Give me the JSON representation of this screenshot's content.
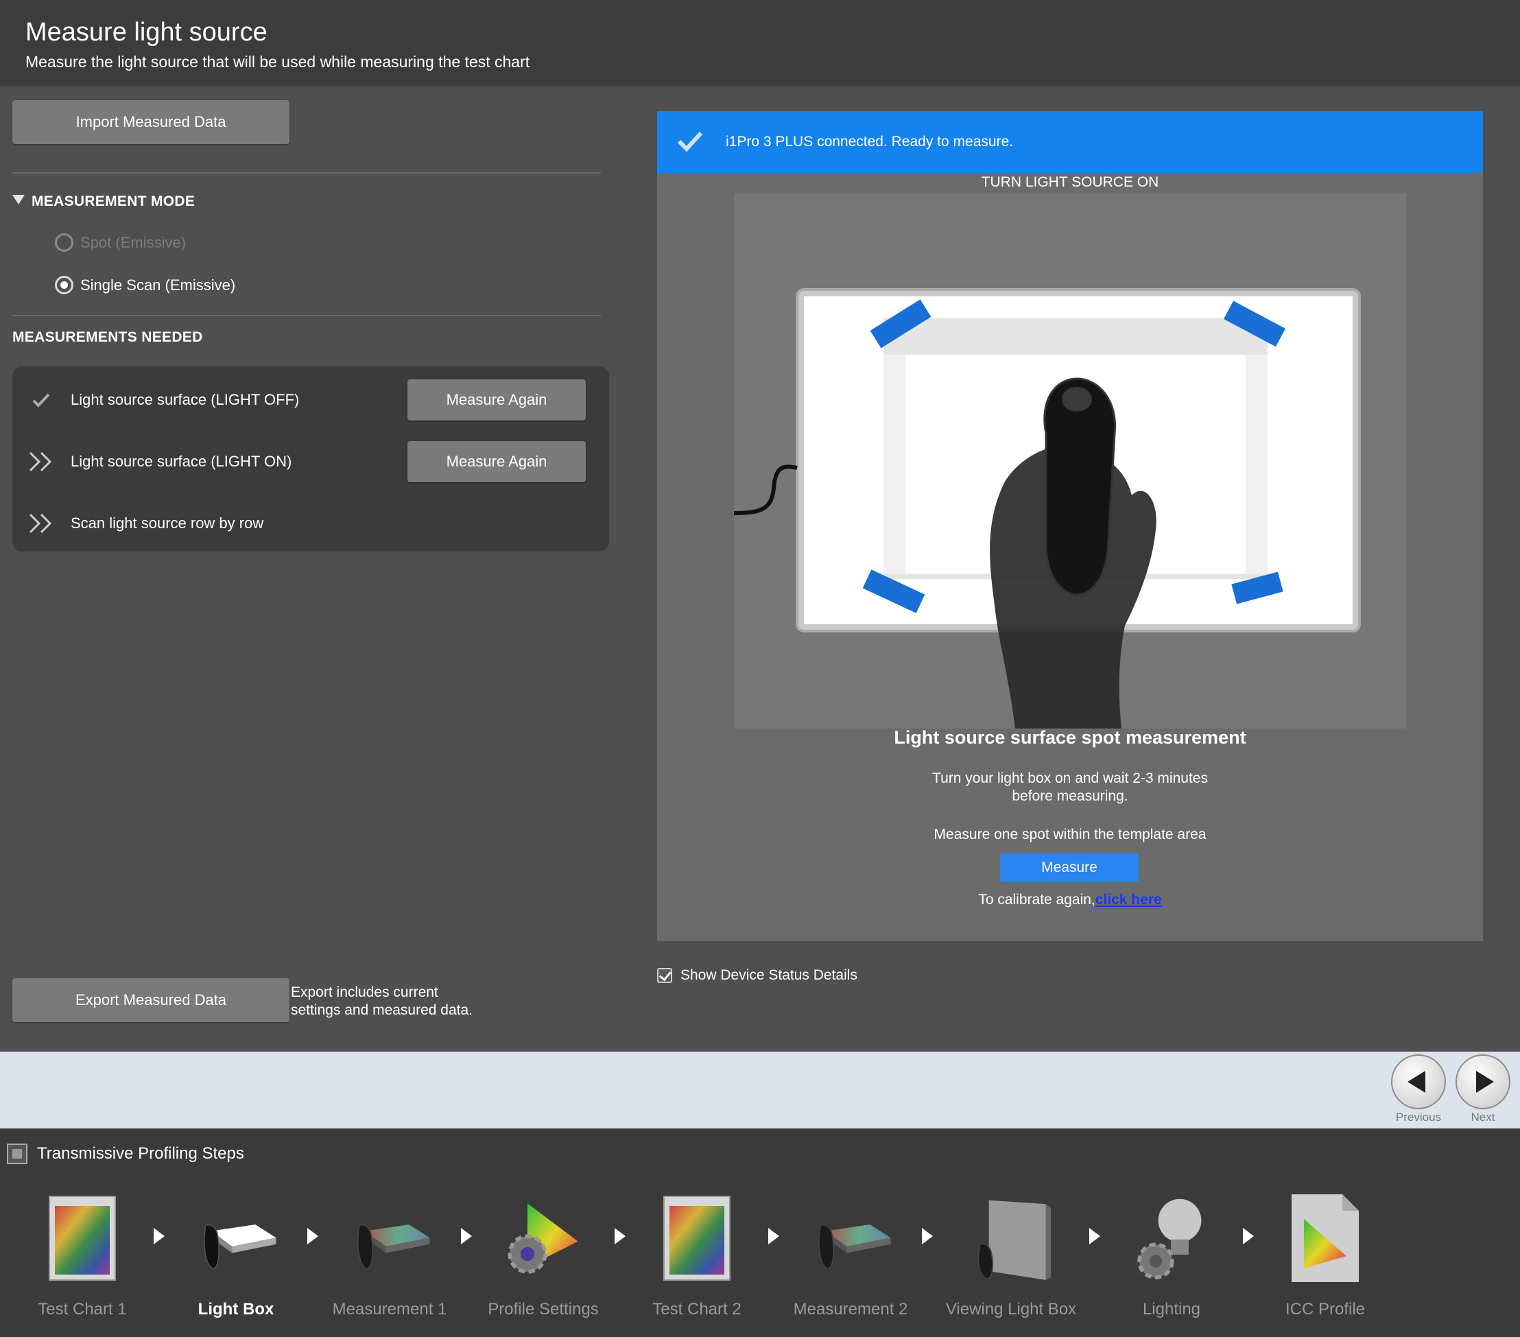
{
  "header": {
    "title": "Measure light source",
    "subtitle": "Measure the light source that will be used while measuring the test chart"
  },
  "left": {
    "import_label": "Import Measured Data",
    "mode_heading": "MEASUREMENT MODE",
    "mode_options": [
      {
        "label": "Spot (Emissive)",
        "selected": false,
        "enabled": false
      },
      {
        "label": "Single Scan (Emissive)",
        "selected": true,
        "enabled": true
      }
    ],
    "needed_heading": "MEASUREMENTS NEEDED",
    "measurements": [
      {
        "label": "Light source surface (LIGHT OFF)",
        "status": "done",
        "button": "Measure Again"
      },
      {
        "label": "Light source surface (LIGHT ON)",
        "status": "current",
        "button": "Measure Again"
      },
      {
        "label": "Scan light source row by row",
        "status": "pending",
        "button": ""
      }
    ],
    "export_label": "Export Measured Data",
    "export_note_1": "Export includes current",
    "export_note_2": "settings and measured data."
  },
  "right": {
    "status_text": "i1Pro 3 PLUS connected. Ready to measure.",
    "instruction_heading": "TURN LIGHT SOURCE ON",
    "title": "Light source surface spot measurement",
    "para1_line1": "Turn your light box on and wait 2-3 minutes",
    "para1_line2": "before measuring.",
    "para2": "Measure one spot within the template area",
    "measure_label": "Measure",
    "calibrate_prefix": "To calibrate again,",
    "calibrate_link": "click here",
    "show_status_label": "Show Device Status Details"
  },
  "nav": {
    "previous_label": "Previous",
    "next_label": "Next"
  },
  "steps": {
    "heading": "Transmissive Profiling Steps",
    "items": [
      {
        "label": "Test Chart 1",
        "icon": "test-chart-icon",
        "active": false
      },
      {
        "label": "Light Box",
        "icon": "light-box-icon",
        "active": true
      },
      {
        "label": "Measurement 1",
        "icon": "measurement-icon",
        "active": false
      },
      {
        "label": "Profile Settings",
        "icon": "profile-settings-icon",
        "active": false
      },
      {
        "label": "Test Chart 2",
        "icon": "test-chart-icon",
        "active": false
      },
      {
        "label": "Measurement 2",
        "icon": "measurement-icon",
        "active": false
      },
      {
        "label": "Viewing Light Box",
        "icon": "viewing-light-box-icon",
        "active": false
      },
      {
        "label": "Lighting",
        "icon": "lighting-icon",
        "active": false
      },
      {
        "label": "ICC Profile",
        "icon": "icc-profile-icon",
        "active": false
      }
    ]
  },
  "colors": {
    "accent": "#1583ee",
    "button": "#7a7a7a",
    "tape": "#1a6fd6"
  }
}
